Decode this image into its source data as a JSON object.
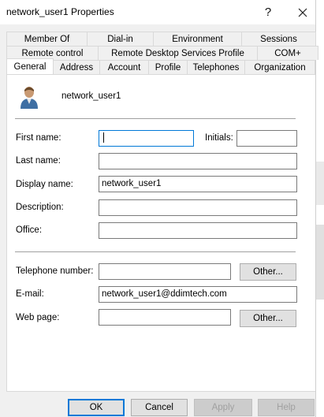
{
  "window": {
    "title": "network_user1 Properties",
    "help": "?"
  },
  "tabs": {
    "row1": [
      "Member Of",
      "Dial-in",
      "Environment",
      "Sessions"
    ],
    "row2": [
      "Remote control",
      "Remote Desktop Services Profile",
      "COM+"
    ],
    "row3": [
      "General",
      "Address",
      "Account",
      "Profile",
      "Telephones",
      "Organization"
    ],
    "active": "General"
  },
  "header": {
    "user_name": "network_user1"
  },
  "form": {
    "first_name": {
      "label": "First name:",
      "value": ""
    },
    "initials": {
      "label": "Initials:",
      "value": ""
    },
    "last_name": {
      "label": "Last name:",
      "value": ""
    },
    "display_name": {
      "label": "Display name:",
      "value": "network_user1"
    },
    "description": {
      "label": "Description:",
      "value": ""
    },
    "office": {
      "label": "Office:",
      "value": ""
    },
    "telephone": {
      "label": "Telephone number:",
      "value": ""
    },
    "email": {
      "label": "E-mail:",
      "value": "network_user1@ddimtech.com"
    },
    "web_page": {
      "label": "Web page:",
      "value": ""
    }
  },
  "buttons": {
    "other": "Other...",
    "ok": "OK",
    "cancel": "Cancel",
    "apply": "Apply",
    "help": "Help"
  },
  "colors": {
    "focus_accent": "#0078d7",
    "panel_bg": "#ffffff",
    "window_bg": "#f0f0f0"
  }
}
